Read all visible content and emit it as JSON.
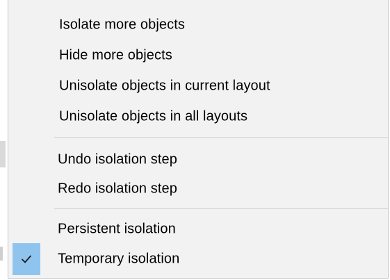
{
  "menu": {
    "group1": [
      {
        "label": "Isolate more objects"
      },
      {
        "label": "Hide more objects"
      },
      {
        "label": "Unisolate objects in current layout"
      },
      {
        "label": "Unisolate objects in all layouts"
      }
    ],
    "group2": [
      {
        "label": "Undo isolation step"
      },
      {
        "label": "Redo isolation step"
      }
    ],
    "group3": [
      {
        "label": "Persistent isolation",
        "checked": false
      },
      {
        "label": "Temporary isolation",
        "checked": true
      }
    ]
  },
  "icons": {
    "checkmark": "check-icon"
  },
  "colors": {
    "menu_background": "#f2f2f2",
    "check_highlight": "#8fc4ee",
    "separator": "#cfcfcf"
  }
}
